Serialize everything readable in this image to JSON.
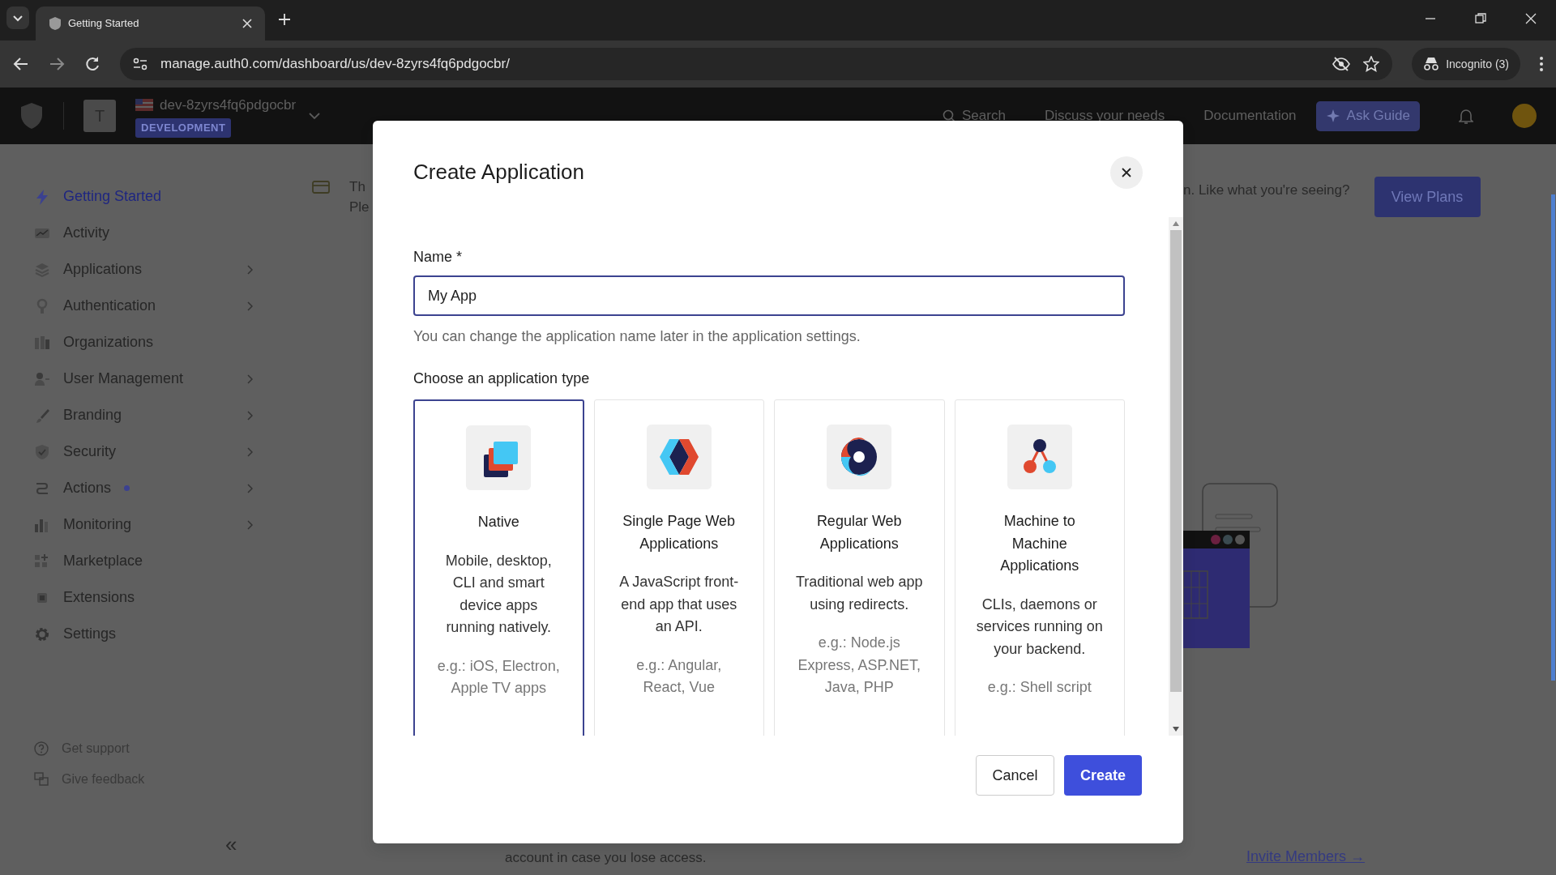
{
  "browser": {
    "tab_title": "Getting Started",
    "url": "manage.auth0.com/dashboard/us/dev-8zyrs4fq6pdgocbr/",
    "profile": "Incognito (3)"
  },
  "app_header": {
    "tenant_initial": "T",
    "tenant_name": "dev-8zyrs4fq6pdgocbr",
    "environment": "DEVELOPMENT",
    "search": "Search",
    "links": [
      "Discuss your needs",
      "Documentation"
    ],
    "ask_button": "Ask Guide"
  },
  "sidebar": {
    "items": [
      {
        "label": "Getting Started",
        "selected": true,
        "expandable": false,
        "dot": false
      },
      {
        "label": "Activity",
        "selected": false,
        "expandable": false,
        "dot": false
      },
      {
        "label": "Applications",
        "selected": false,
        "expandable": true,
        "dot": false
      },
      {
        "label": "Authentication",
        "selected": false,
        "expandable": true,
        "dot": false
      },
      {
        "label": "Organizations",
        "selected": false,
        "expandable": false,
        "dot": false
      },
      {
        "label": "User Management",
        "selected": false,
        "expandable": true,
        "dot": false
      },
      {
        "label": "Branding",
        "selected": false,
        "expandable": true,
        "dot": false
      },
      {
        "label": "Security",
        "selected": false,
        "expandable": true,
        "dot": false
      },
      {
        "label": "Actions",
        "selected": false,
        "expandable": true,
        "dot": true
      },
      {
        "label": "Monitoring",
        "selected": false,
        "expandable": true,
        "dot": false
      },
      {
        "label": "Marketplace",
        "selected": false,
        "expandable": false,
        "dot": false
      },
      {
        "label": "Extensions",
        "selected": false,
        "expandable": false,
        "dot": false
      },
      {
        "label": "Settings",
        "selected": false,
        "expandable": false,
        "dot": false
      }
    ],
    "footer_links": [
      {
        "label": "Get support"
      },
      {
        "label": "Give feedback"
      }
    ],
    "collapse": "«"
  },
  "background": {
    "banner_left": [
      "Th",
      "Ple"
    ],
    "banner_right": "n. Like what you're seeing?",
    "view_plans": "View Plans",
    "bottom_text": "account in case you lose access.",
    "invite_link": "Invite Members →"
  },
  "modal": {
    "title": "Create Application",
    "name_label": "Name",
    "required_mark": "*",
    "name_value": "My App",
    "help": "You can change the application name later in the application settings.",
    "type_label": "Choose an application type",
    "types": [
      {
        "kind": "native",
        "title": "Native",
        "description": "Mobile, desktop, CLI and smart device apps running natively.",
        "examples": "e.g.: iOS, Electron, Apple TV apps",
        "selected": true
      },
      {
        "kind": "spa",
        "title": "Single Page Web Applications",
        "description": "A JavaScript front-end app that uses an API.",
        "examples": "e.g.: Angular, React, Vue",
        "selected": false
      },
      {
        "kind": "regular",
        "title": "Regular Web Applications",
        "description": "Traditional web app using redirects.",
        "examples": "e.g.: Node.js Express, ASP.NET, Java, PHP",
        "selected": false
      },
      {
        "kind": "m2m",
        "title": "Machine to Machine Applications",
        "description": "CLIs, daemons or services running on your backend.",
        "examples": "e.g.: Shell script",
        "selected": false
      }
    ],
    "cancel": "Cancel",
    "create": "Create"
  }
}
